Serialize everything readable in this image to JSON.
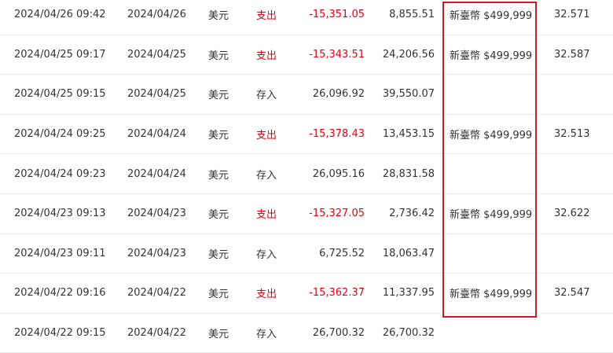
{
  "colors": {
    "text": "#333333",
    "negative": "#e60012",
    "highlight_border": "#d7161f",
    "row_border": "#ececec"
  },
  "rows": [
    {
      "datetime": "2024/04/26 09:42",
      "date": "2024/04/26",
      "currency": "美元",
      "type": "支出",
      "amount": "-15,351.05",
      "balance": "8,855.51",
      "note": "新臺幣 $499,999",
      "rate": "32.571",
      "negative": true
    },
    {
      "datetime": "2024/04/25 09:17",
      "date": "2024/04/25",
      "currency": "美元",
      "type": "支出",
      "amount": "-15,343.51",
      "balance": "24,206.56",
      "note": "新臺幣 $499,999",
      "rate": "32.587",
      "negative": true
    },
    {
      "datetime": "2024/04/25 09:15",
      "date": "2024/04/25",
      "currency": "美元",
      "type": "存入",
      "amount": "26,096.92",
      "balance": "39,550.07",
      "note": "",
      "rate": "",
      "negative": false
    },
    {
      "datetime": "2024/04/24 09:25",
      "date": "2024/04/24",
      "currency": "美元",
      "type": "支出",
      "amount": "-15,378.43",
      "balance": "13,453.15",
      "note": "新臺幣 $499,999",
      "rate": "32.513",
      "negative": true
    },
    {
      "datetime": "2024/04/24 09:23",
      "date": "2024/04/24",
      "currency": "美元",
      "type": "存入",
      "amount": "26,095.16",
      "balance": "28,831.58",
      "note": "",
      "rate": "",
      "negative": false
    },
    {
      "datetime": "2024/04/23 09:13",
      "date": "2024/04/23",
      "currency": "美元",
      "type": "支出",
      "amount": "-15,327.05",
      "balance": "2,736.42",
      "note": "新臺幣 $499,999",
      "rate": "32.622",
      "negative": true
    },
    {
      "datetime": "2024/04/23 09:11",
      "date": "2024/04/23",
      "currency": "美元",
      "type": "存入",
      "amount": "6,725.52",
      "balance": "18,063.47",
      "note": "",
      "rate": "",
      "negative": false
    },
    {
      "datetime": "2024/04/22 09:16",
      "date": "2024/04/22",
      "currency": "美元",
      "type": "支出",
      "amount": "-15,362.37",
      "balance": "11,337.95",
      "note": "新臺幣 $499,999",
      "rate": "32.547",
      "negative": true
    },
    {
      "datetime": "2024/04/22 09:15",
      "date": "2024/04/22",
      "currency": "美元",
      "type": "存入",
      "amount": "26,700.32",
      "balance": "26,700.32",
      "note": "",
      "rate": "",
      "negative": false
    }
  ]
}
